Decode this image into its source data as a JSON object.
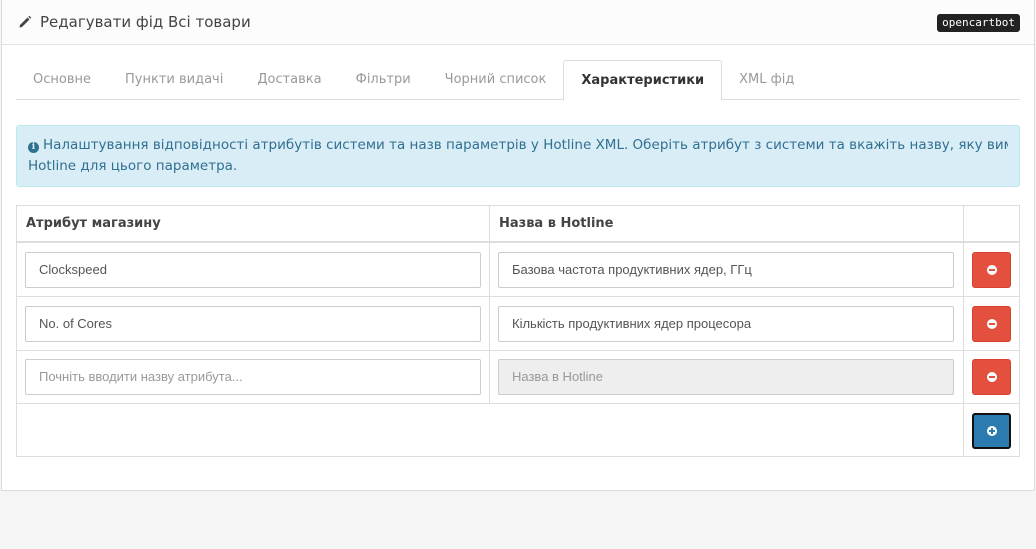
{
  "header": {
    "title": "Редагувати фід Всі товари",
    "title_icon": "pencil-icon",
    "brand": "opencartbot"
  },
  "tabs": [
    {
      "label": "Основне",
      "active": false
    },
    {
      "label": "Пункти видачі",
      "active": false
    },
    {
      "label": "Доставка",
      "active": false
    },
    {
      "label": "Фільтри",
      "active": false
    },
    {
      "label": "Чорний список",
      "active": false
    },
    {
      "label": "Характеристики",
      "active": true
    },
    {
      "label": "XML фід",
      "active": false
    }
  ],
  "alert": {
    "icon": "info-circle-icon",
    "line1": "Налаштування відповідності атрибутів системи та назв параметрів у Hotline XML. Оберіть атрибут з системи та вкажіть назву, яку вимагає",
    "line2": "Hotline для цього параметра."
  },
  "table": {
    "columns": [
      "Атрибут магазину",
      "Назва в Hotline"
    ],
    "rows": [
      {
        "attribute": "Clockspeed",
        "hotline_name": "Базова частота продуктивних ядер, ГГц"
      },
      {
        "attribute": "No. of Cores",
        "hotline_name": "Кількість продуктивних ядер процесора"
      }
    ],
    "new_row": {
      "attribute_placeholder": "Почніть вводити назву атрибута...",
      "hotline_placeholder": "Назва в Hotline"
    }
  },
  "colors": {
    "danger": "#e3503e",
    "primary": "#2b7bb0",
    "alert_bg": "#d9edf7",
    "alert_text": "#31708f"
  }
}
